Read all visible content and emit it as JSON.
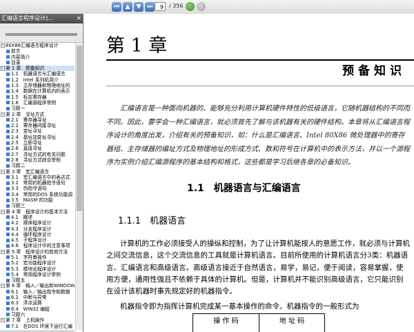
{
  "toolbar": {
    "page_current": "9",
    "page_total": "/ 356"
  },
  "sidebar": {
    "tab_title": "汇编语言程序设计]...",
    "close": "×",
    "tree": [
      {
        "t": "80X86汇编语言程序设计",
        "tw": "−"
      },
      {
        "t": "前言",
        "i": 1
      },
      {
        "t": "内容简介",
        "i": 1
      },
      {
        "t": "目录",
        "i": 1
      },
      {
        "t": "第 1 章　预备知识",
        "tw": "−",
        "i": 0,
        "sel": true
      },
      {
        "t": "1.1　机器语言与汇编语言",
        "i": 1
      },
      {
        "t": "1.2　Intel 系列机简介",
        "i": 1
      },
      {
        "t": "1.3　主存储器和物理地址的",
        "i": 1
      },
      {
        "t": "1.4　数据在计算机内的表示",
        "i": 1
      },
      {
        "t": "1.5　标志寄存器",
        "i": 1
      },
      {
        "t": "1.6　汇编源程序举例",
        "i": 1
      },
      {
        "t": "习题一",
        "i": 1
      },
      {
        "t": "第 2 章　寻址方式",
        "tw": "−",
        "i": 0
      },
      {
        "t": "2.1　寄存器寻址",
        "i": 1
      },
      {
        "t": "2.2　寄存器间接寻址",
        "i": 1
      },
      {
        "t": "2.3　变址寻址",
        "i": 1
      },
      {
        "t": "2.4　基址加变址寻址",
        "i": 1
      },
      {
        "t": "2.5　立即寻址",
        "i": 1
      },
      {
        "t": "2.6　直接寻址",
        "i": 1
      },
      {
        "t": "2.7　寻址方式的有关问题",
        "i": 1
      },
      {
        "t": "2.8　寻址方式综合举例",
        "i": 1
      },
      {
        "t": "习题二",
        "i": 1
      },
      {
        "t": "第 3 章　宏汇编语言",
        "tw": "−",
        "i": 0
      },
      {
        "t": "3.1　宏汇编语言中的表达式",
        "i": 1
      },
      {
        "t": "3.2　常用的机器指令语句",
        "i": 1
      },
      {
        "t": "3.3　伪指令语句",
        "i": 1
      },
      {
        "t": "3.4　常用的DOS 系统功能调",
        "i": 1
      },
      {
        "t": "3.5　MASM 的功能",
        "i": 1
      },
      {
        "t": "习题三",
        "i": 1
      },
      {
        "t": "第 4 章　程序设计的基本方法",
        "tw": "−",
        "i": 0
      },
      {
        "t": "4.1　概述",
        "i": 1
      },
      {
        "t": "4.2　顺序程序设计",
        "i": 1
      },
      {
        "t": "4.3　分支程序设计",
        "i": 1
      },
      {
        "t": "4.4　循环程序设计",
        "i": 1
      },
      {
        "t": "4.5　子程序设计",
        "i": 1
      },
      {
        "t": "4.6　程序设计中的注意事项",
        "i": 1
      },
      {
        "t": "第 5 章　程序设计的其他方法",
        "tw": "−",
        "i": 0
      },
      {
        "t": "5.1　字符串操作",
        "i": 1
      },
      {
        "t": "5.2　宏功能程序设计",
        "i": 1
      },
      {
        "t": "5.3　模块化程序设计",
        "i": 1
      },
      {
        "t": "5.4　常用程序设计举例",
        "i": 1
      },
      {
        "t": "习题五",
        "i": 1
      },
      {
        "t": "第 6 章　输入／输出和WINDOWS",
        "tw": "−",
        "i": 0
      },
      {
        "t": "6.1　输入／输出指令和数据",
        "i": 1
      },
      {
        "t": "6.2　中断与异常",
        "i": 1
      },
      {
        "t": "6.3　浮点运算",
        "i": 1
      },
      {
        "t": "6.4　WIN32 编程",
        "i": 1
      },
      {
        "t": "习题六",
        "i": 1
      },
      {
        "t": "第 7 章　上机操作",
        "tw": "−",
        "i": 0
      },
      {
        "t": "7.1　在DOS 环境下运行汇编",
        "i": 1
      }
    ]
  },
  "content": {
    "chapter": "第 1 章",
    "chapter_subtitle": "预备知识",
    "intro": "汇编语言是一种面向机器的、能够充分利用计算机硬件特性的低级语言，它随机器结构的不同而不同。因此，要学会一种汇编语言，就必须首先了解与该机器有关的硬件结构。本章将从汇编语言程序设计的角度出发，介绍有关的预备知识，如：什么是汇编语言、Intel 80X86 微处理器中的寄存器组、主存储器的编址方式及物理地址的形成方式、数和符号在计算机中的表示方法，并以一个源程序为实例介绍汇编源程序的基本结构和格式，这些都是学习后继各章的必备知识。",
    "section_1_1": "1.1　机器语言与汇编语言",
    "section_1_1_1": "1.1.1　机器语言",
    "para1": "计算机的工作必须接受人的操纵和控制，为了让计算机能按人的意愿工作，就必须与计算机之间交流信息，这个交流信息的工具就是计算机语言。目前所使用的计算机语言分3类：机器语言、汇编语言和高级语言。高级语言接近于自然语言，易学，易记，便于阅读，容易掌握，使用方便，通用性强且不依赖于具体的计算机。但是，计算机并不能识别高级语言，它只能识别在设计该机器时事先规定好的机器指令。",
    "para2": "机器指令即为指挥计算机完成某一基本操作的命令。机器指令的一般形式为",
    "table": {
      "col1": "操 作 码",
      "col2": "地 址 码"
    }
  }
}
